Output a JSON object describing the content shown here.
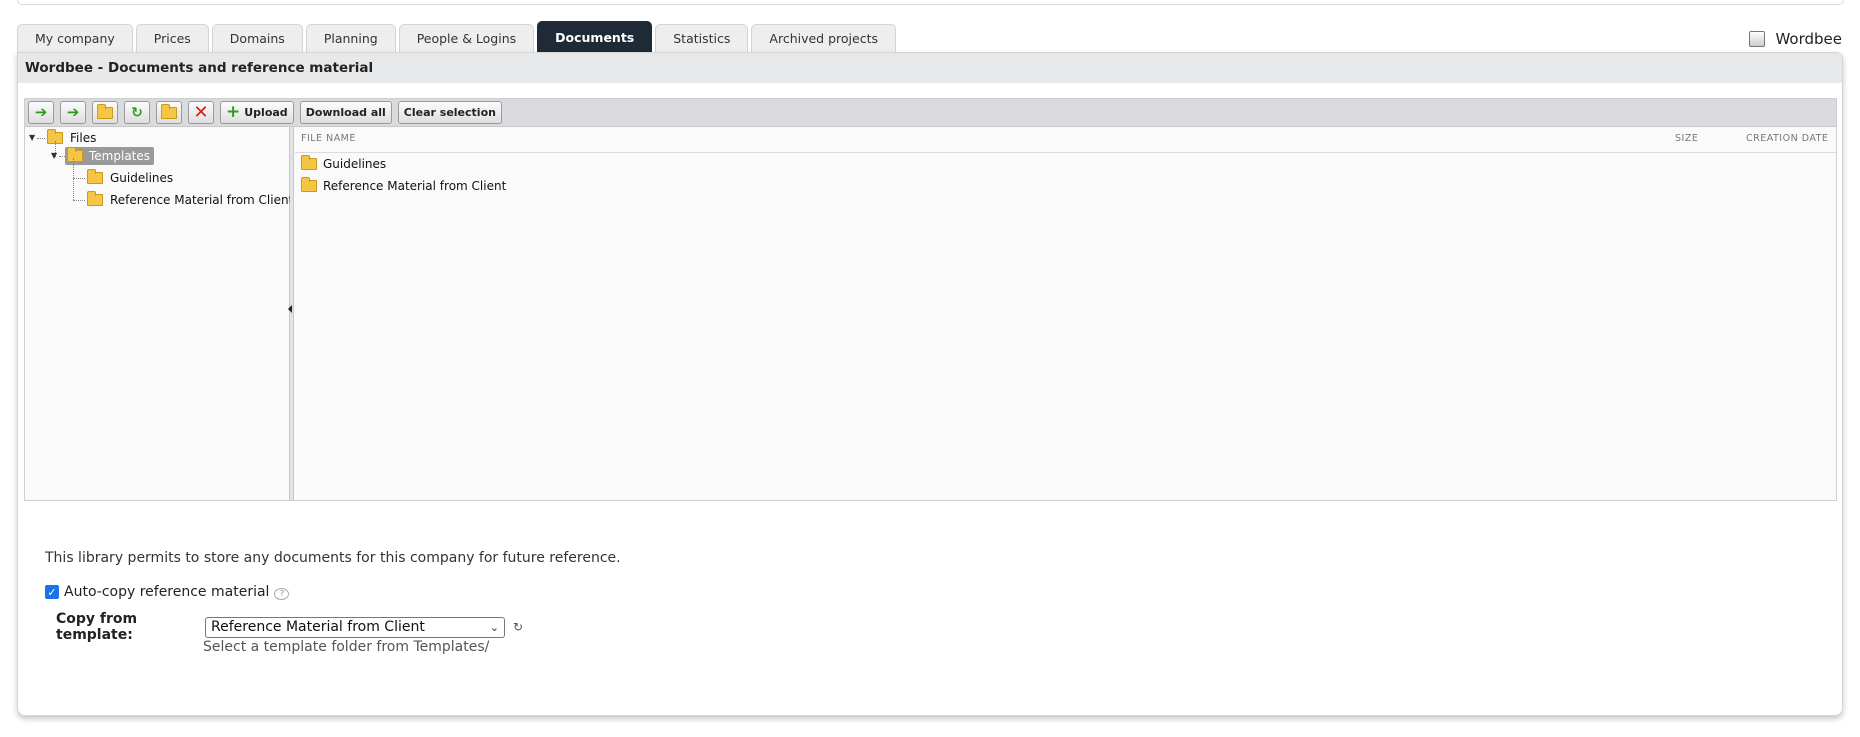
{
  "tabs": [
    {
      "label": "My company",
      "active": false
    },
    {
      "label": "Prices",
      "active": false
    },
    {
      "label": "Domains",
      "active": false
    },
    {
      "label": "Planning",
      "active": false
    },
    {
      "label": "People & Logins",
      "active": false
    },
    {
      "label": "Documents",
      "active": true
    },
    {
      "label": "Statistics",
      "active": false
    },
    {
      "label": "Archived projects",
      "active": false
    }
  ],
  "brand": {
    "label": "Wordbee"
  },
  "panel": {
    "title": "Wordbee - Documents and reference material"
  },
  "toolbar": {
    "upload_label": "Upload",
    "download_all_label": "Download all",
    "clear_selection_label": "Clear selection"
  },
  "tree": {
    "root": "Files",
    "templates": "Templates",
    "children": [
      "Guidelines",
      "Reference Material from Client"
    ]
  },
  "list": {
    "headers": {
      "name": "FILE NAME",
      "size": "SIZE",
      "date": "CREATION DATE"
    },
    "rows": [
      "Guidelines",
      "Reference Material from Client"
    ]
  },
  "library": {
    "description": "This library permits to store any documents for this company for future reference.",
    "autocopy_label": "Auto-copy reference material",
    "autocopy_checked": true,
    "template_label": "Copy from template:",
    "template_value": "Reference Material from Client",
    "template_hint": "Select a template folder from Templates/"
  },
  "colors": {
    "active_tab": "#1f2a37",
    "title_bar": "#e7e8ea",
    "folder": "#f4c644",
    "checkbox": "#1a73e8"
  }
}
